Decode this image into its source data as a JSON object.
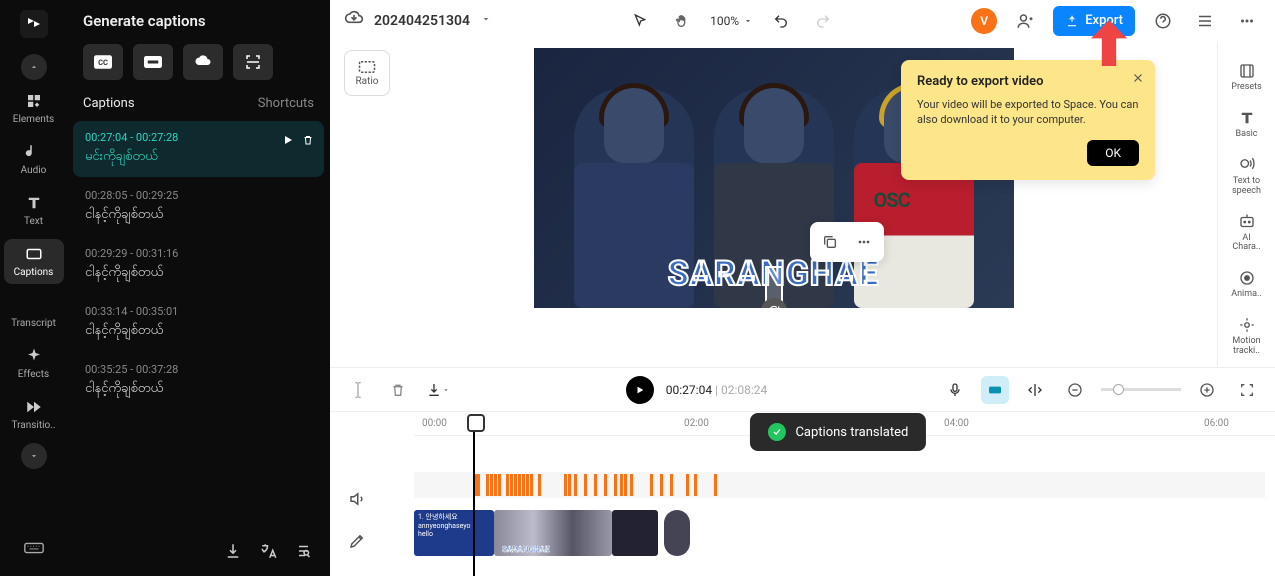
{
  "rail": {
    "items": [
      {
        "name": "elements",
        "label": "Elements"
      },
      {
        "name": "audio",
        "label": "Audio"
      },
      {
        "name": "text",
        "label": "Text"
      },
      {
        "name": "captions",
        "label": "Captions"
      },
      {
        "name": "transcript",
        "label": "Transcript"
      },
      {
        "name": "effects",
        "label": "Effects"
      },
      {
        "name": "transitions",
        "label": "Transitio.."
      }
    ]
  },
  "panel": {
    "title": "Generate captions",
    "section": "Captions",
    "shortcuts": "Shortcuts",
    "list": [
      {
        "time": "00:27:04 - 00:27:28",
        "txt": "မင်းကိုချစ်တယ်",
        "active": true
      },
      {
        "time": "00:28:05 - 00:29:25",
        "txt": "ငါနင့်ကိုချစ်တယ်"
      },
      {
        "time": "00:29:29 - 00:31:16",
        "txt": "ငါနင့်ကိုချစ်တယ်"
      },
      {
        "time": "00:33:14 - 00:35:01",
        "txt": "ငါနင့်ကိုချစ်တယ်"
      },
      {
        "time": "00:35:25 - 00:37:28",
        "txt": "ငါနင့်ကိုချစ်တယ်"
      }
    ]
  },
  "header": {
    "project": "202404251304",
    "zoom": "100%",
    "export": "Export",
    "avatar": "V"
  },
  "ratio": "Ratio",
  "preview_caption": "SARANGHAE",
  "tooltip": {
    "title": "Ready to export video",
    "body": "Your video will be exported to Space. You can also download it to your computer.",
    "ok": "OK"
  },
  "toast": "Captions translated",
  "timeline": {
    "pos": "00:27:04",
    "dur": "02:08:24",
    "marks": [
      "00:00",
      "02:00",
      "04:00",
      "06:00"
    ]
  },
  "clip1": {
    "l1": "1. 안녕하세요",
    "l2": "annyeonghaseyo",
    "l3": "hello"
  },
  "clip_overlay": "SARANGHAE",
  "rrail": [
    {
      "name": "presets",
      "label": "Presets"
    },
    {
      "name": "basic",
      "label": "Basic"
    },
    {
      "name": "tts",
      "label": "Text to\nspeech"
    },
    {
      "name": "ai-chara",
      "label": "AI\nChara.."
    },
    {
      "name": "animation",
      "label": "Anima.."
    },
    {
      "name": "motion",
      "label": "Motion\ntracki.."
    }
  ]
}
